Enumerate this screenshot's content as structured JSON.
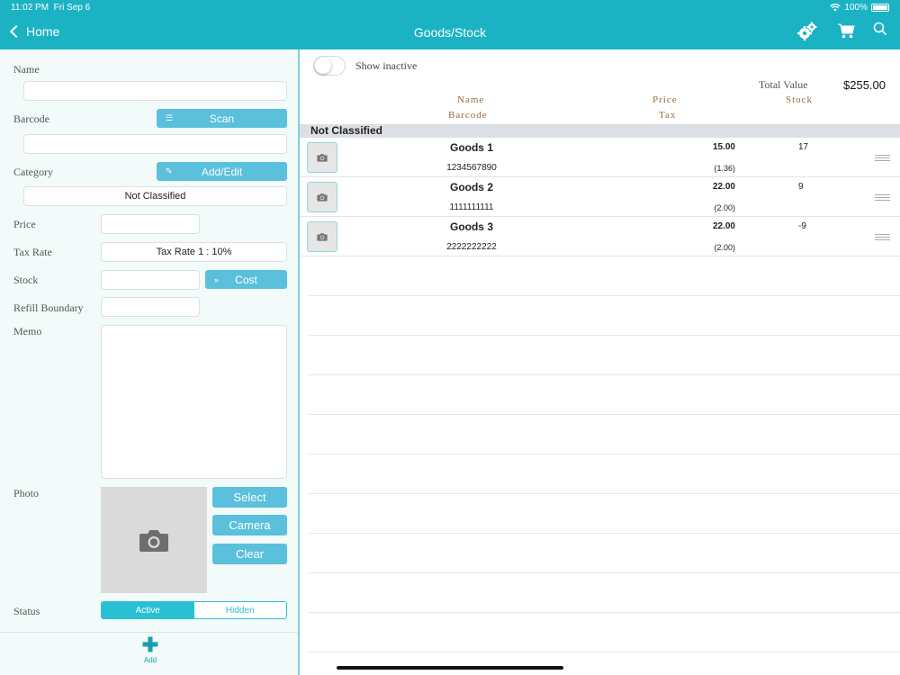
{
  "status": {
    "time": "11:02 PM",
    "date": "Fri Sep 6",
    "battery": "100%"
  },
  "nav": {
    "back_label": "Home",
    "title": "Goods/Stock"
  },
  "form": {
    "name_label": "Name",
    "barcode_label": "Barcode",
    "scan_label": "Scan",
    "category_label": "Category",
    "add_edit_label": "Add/Edit",
    "category_value": "Not Classified",
    "price_label": "Price",
    "tax_rate_label": "Tax Rate",
    "tax_rate_value": "Tax Rate 1 : 10%",
    "stock_label": "Stock",
    "cost_label": "Cost",
    "refill_label": "Refill Boundary",
    "memo_label": "Memo",
    "photo_label": "Photo",
    "select_label": "Select",
    "camera_label": "Camera",
    "clear_label": "Clear",
    "status_label": "Status",
    "status_active": "Active",
    "status_hidden": "Hidden",
    "add_label": "Add"
  },
  "list": {
    "show_inactive": "Show inactive",
    "total_value_label": "Total Value",
    "total_value": "$255.00",
    "col_name": "Name",
    "col_barcode": "Barcode",
    "col_price": "Price",
    "col_tax": "Tax",
    "col_stock": "Stock",
    "section": "Not Classified",
    "rows": [
      {
        "name": "Goods 1",
        "barcode": "1234567890",
        "price": "15.00",
        "tax": "(1.36)",
        "stock": "17"
      },
      {
        "name": "Goods 2",
        "barcode": "1111111111",
        "price": "22.00",
        "tax": "(2.00)",
        "stock": "9"
      },
      {
        "name": "Goods 3",
        "barcode": "2222222222",
        "price": "22.00",
        "tax": "(2.00)",
        "stock": "-9"
      }
    ]
  },
  "colors": {
    "header": "#1bb3c3",
    "button": "#5bc0dc",
    "accent": "#2ac0d4",
    "column_header": "#9a6a3a"
  }
}
